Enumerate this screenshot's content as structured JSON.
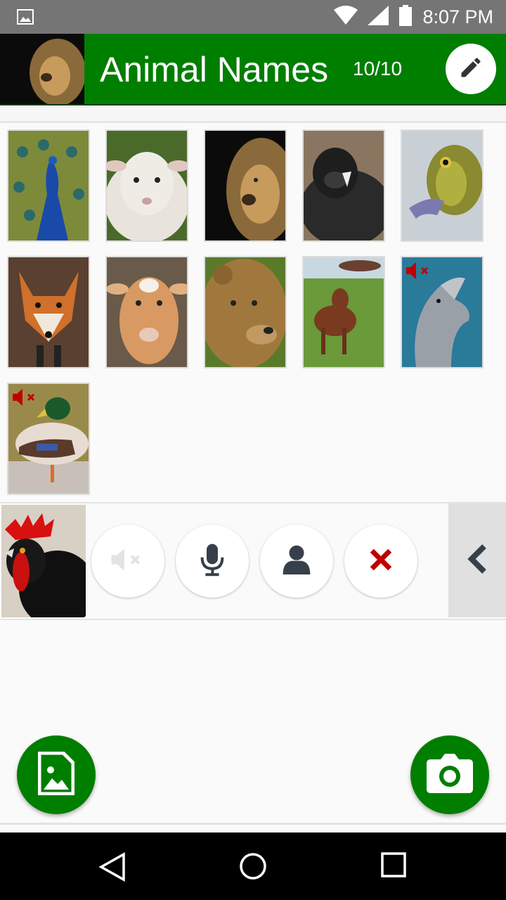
{
  "status_bar": {
    "time": "8:07 PM",
    "icons": [
      "image-notification-icon",
      "wifi-icon",
      "signal-icon",
      "battery-icon"
    ]
  },
  "header": {
    "title": "Animal Names",
    "count": "10/10",
    "thumbnail": "lion",
    "edit_icon": "pencil-icon",
    "background_color": "#007e00"
  },
  "grid": {
    "items": [
      {
        "animal": "peacock",
        "muted": false
      },
      {
        "animal": "lamb",
        "muted": false
      },
      {
        "animal": "lion",
        "muted": false
      },
      {
        "animal": "gorilla",
        "muted": false
      },
      {
        "animal": "frog",
        "muted": false
      },
      {
        "animal": "fox",
        "muted": false
      },
      {
        "animal": "goat",
        "muted": false
      },
      {
        "animal": "bear",
        "muted": false
      },
      {
        "animal": "cow",
        "muted": false
      },
      {
        "animal": "dolphin",
        "muted": true
      },
      {
        "animal": "duck",
        "muted": true
      }
    ]
  },
  "selection_bar": {
    "selected": "rooster",
    "buttons": [
      "mute-icon",
      "microphone-icon",
      "person-icon",
      "delete-icon"
    ],
    "collapse_icon": "chevron-left-icon"
  },
  "fabs": {
    "gallery_icon": "image-icon",
    "camera_icon": "camera-icon"
  },
  "nav_bar": {
    "icons": [
      "back-icon",
      "home-icon",
      "recents-icon"
    ]
  },
  "colors": {
    "accent": "#007e00",
    "delete": "#c00000",
    "mute_badge": "#c00000"
  }
}
